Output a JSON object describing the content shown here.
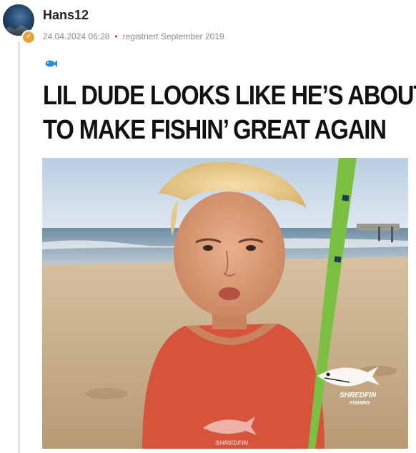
{
  "post": {
    "username": "Hans12",
    "date": "24.04.2024 06:28",
    "registered": "registriert September 2019",
    "separator": "•"
  },
  "meme": {
    "line1": "LIL DUDE LOOKS LIKE HE’S ABOUT",
    "line2": "TO MAKE FISHIN’ GREAT AGAIN",
    "watermark_line1": "SHREDFIN",
    "watermark_line2": "FISHING",
    "shirt_text": "SHREDFIN"
  },
  "icons": {
    "badge": "check-badge-icon",
    "fish": "fish-icon"
  },
  "colors": {
    "fish_blue": "#2a8fd6",
    "badge_orange": "#e6a33a",
    "meta_gray": "#8a8a8a",
    "separator_red": "#cc3333"
  }
}
